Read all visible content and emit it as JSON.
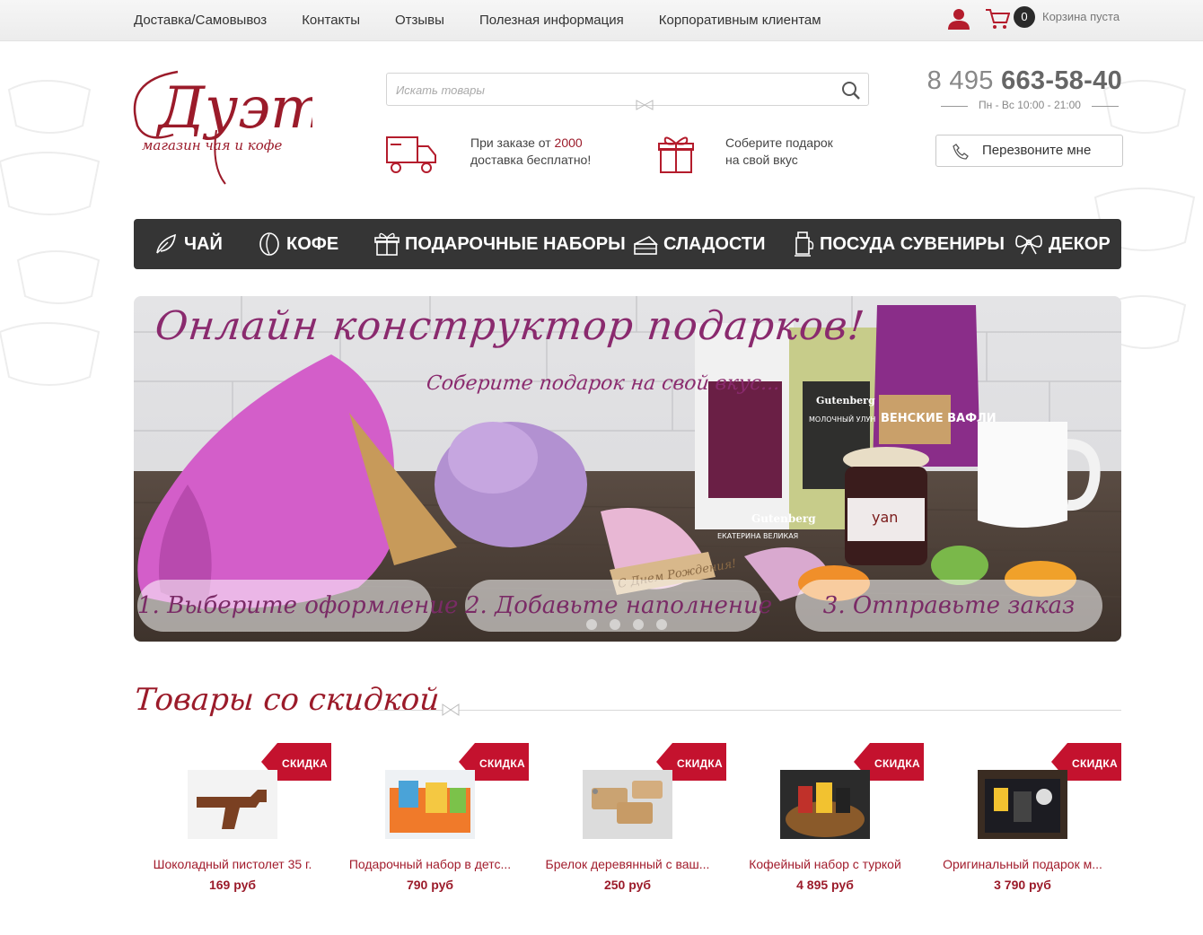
{
  "topnav": {
    "links": [
      "Доставка/Самовывоз",
      "Контакты",
      "Отзывы",
      "Полезная информация",
      "Корпоративным клиентам"
    ],
    "cart_count": "0",
    "cart_label": "Корзина пуста"
  },
  "header": {
    "logo_name": "Дуэт",
    "logo_tagline": "магазин чая и кофе",
    "search_placeholder": "Искать товары",
    "promo_delivery_line1": "При заказе от",
    "promo_delivery_amount": "2000",
    "promo_delivery_line2": "доставка бесплатно!",
    "promo_gift_line1": "Соберите подарок",
    "promo_gift_line2": "на свой вкус",
    "phone_prefix": "8 495",
    "phone_number": "663-58-40",
    "hours": "Пн - Вс 10:00 - 21:00",
    "callback_label": "Перезвоните мне"
  },
  "mainnav": {
    "items": [
      {
        "label": "ЧАЙ",
        "icon": "tea-leaf-icon"
      },
      {
        "label": "КОФЕ",
        "icon": "coffee-bean-icon"
      },
      {
        "label": "ПОДАРОЧНЫЕ НАБОРЫ",
        "icon": "gift-box-icon"
      },
      {
        "label": "СЛАДОСТИ",
        "icon": "cake-icon"
      },
      {
        "label": "ПОСУДА СУВЕНИРЫ",
        "icon": "teapot-icon"
      },
      {
        "label": "ДЕКОР",
        "icon": "bow-icon"
      }
    ]
  },
  "banner": {
    "title": "Онлайн конструктор подарков!",
    "subtitle": "Соберите подарок на свой вкус...",
    "steps": [
      "1. Выберите оформление",
      "2. Добавьте наполнение",
      "3. Отправьте заказ"
    ],
    "labels": {
      "tea1_brand": "Gutenberg",
      "tea1_name": "ЕКАТЕРИНА ВЕЛИКАЯ",
      "tea2_brand": "Gutenberg",
      "tea2_name": "МОЛОЧНЫЙ УЛУН",
      "wafers": "ВЕНСКИЕ ВАФЛИ",
      "jar": "yan",
      "tag": "С Днем Рождения!"
    }
  },
  "discounts": {
    "title": "Товары со скидкой",
    "badge": "СКИДКА",
    "products": [
      {
        "name": "Шоколадный пистолет 35 г.",
        "price": "169 руб"
      },
      {
        "name": "Подарочный набор в детс...",
        "price": "790 руб"
      },
      {
        "name": "Брелок деревянный с ваш...",
        "price": "250 руб"
      },
      {
        "name": "Кофейный набор с туркой",
        "price": "4 895 руб"
      },
      {
        "name": "Оригинальный подарок м...",
        "price": "3 790 руб"
      }
    ]
  },
  "colors": {
    "brand_red": "#9b1b2a",
    "nav_dark": "#353535",
    "banner_purple": "#8a2a6e"
  }
}
